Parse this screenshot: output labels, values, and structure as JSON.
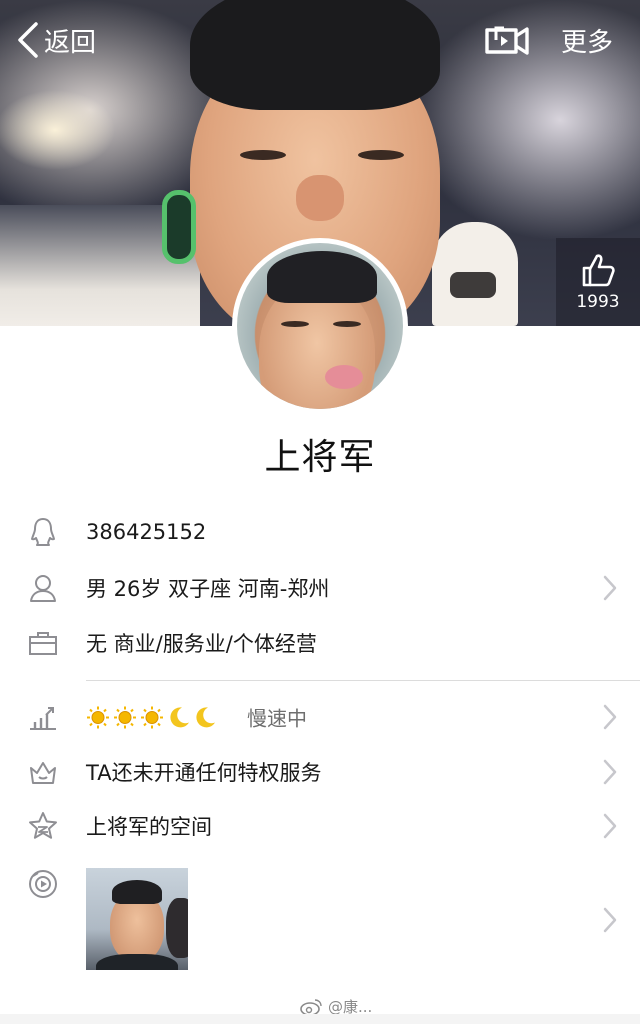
{
  "nav": {
    "back_label": "返回",
    "more_label": "更多",
    "video_icon": "video-camera-icon"
  },
  "like": {
    "icon": "thumbs-up-icon",
    "count": "1993"
  },
  "profile": {
    "nickname": "上将军"
  },
  "rows": {
    "qq": {
      "icon": "qq-penguin-icon",
      "text": "386425152"
    },
    "personal": {
      "icon": "person-icon",
      "text": "男 26岁 双子座 河南-郑州"
    },
    "job": {
      "icon": "briefcase-icon",
      "text": "无 商业/服务业/个体经营"
    },
    "level": {
      "icon": "level-chart-icon",
      "suns": 3,
      "moons": 2,
      "speed_text": "慢速中"
    },
    "privilege": {
      "icon": "crown-icon",
      "text": "TA还未开通任何特权服务"
    },
    "space": {
      "icon": "star-icon",
      "text": "上将军的空间"
    },
    "photos": {
      "icon": "camera-icon"
    }
  },
  "watermark": {
    "icon": "weibo-icon",
    "text": "@康... "
  },
  "colors": {
    "arrow": "#c7c7cc",
    "icon": "#8e8e93",
    "sun": "#f5b700",
    "moon": "#f3c51e"
  }
}
